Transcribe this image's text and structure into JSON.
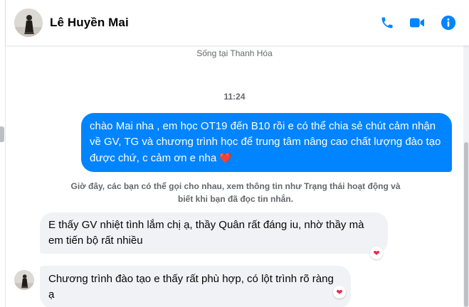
{
  "header": {
    "contact_name": "Lê Huyền Mai",
    "avatar_icon": "profile-photo",
    "actions": [
      {
        "icon": "phone-icon",
        "color": "#0084ff"
      },
      {
        "icon": "video-camera-icon",
        "color": "#0084ff"
      },
      {
        "icon": "info-icon",
        "color": "#0084ff"
      }
    ]
  },
  "conversation": {
    "lives_in": "Sống tại Thanh Hóa",
    "timestamp": "11:24",
    "outgoing": [
      {
        "text": "chào Mai nha , em học OT19 đến B10 rồi e có thể chia sẻ chút cảm nhận về GV, TG và chương trình học để trung tâm nâng cao chất lượng đào tạo được chứ, c cảm ơn e nha",
        "emoji": "❤️"
      }
    ],
    "notice": "Giờ đây, các bạn có thể gọi cho nhau, xem thông tin như Trạng thái hoạt động và biết khi bạn đã đọc tin nhắn.",
    "incoming": [
      {
        "text": "E thấy GV nhiệt tình lắm chị ạ, thầy Quân rất đáng iu, nhờ thầy mà em tiến bộ rất nhiều",
        "reaction": "❤"
      },
      {
        "text": "Chương trình đào tạo e thấy rất phù hợp, có lột trình rõ ràng ạ",
        "reaction": "❤"
      }
    ]
  },
  "colors": {
    "accent": "#0084ff",
    "incoming_bubble": "#f0f2f5",
    "reaction_heart": "#f02849",
    "muted_text": "#65676b"
  }
}
